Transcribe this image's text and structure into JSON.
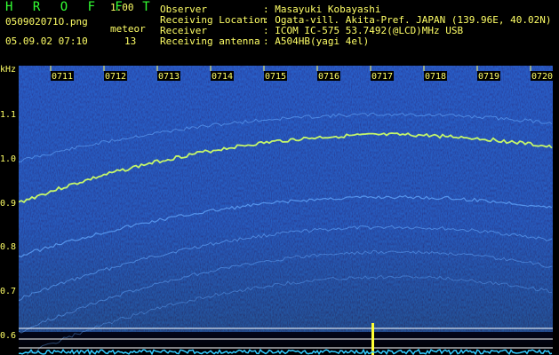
{
  "app": {
    "title": "H R O F F T",
    "version": "1.00"
  },
  "file": {
    "name": "050902071O.png",
    "date_time": "05.09.02 07:10"
  },
  "meteor": {
    "label": "meteor",
    "count": "13"
  },
  "info": {
    "observer_label": "Observer",
    "observer_value": ": Masayuki Kobayashi",
    "location_label": "Receiving Location",
    "location_value": ": Ogata-vill. Akita-Pref. JAPAN (139.96E, 40.02N)",
    "receiver_label": "Receiver",
    "receiver_value": ": ICOM IC-575 53.7492(@LCD)MHz USB",
    "antenna_label": "Receiving antenna",
    "antenna_value": ": A504HB(yagi 4el)"
  },
  "axis": {
    "y_unit": "kHz",
    "y_ticks": [
      "1.1",
      "1.0",
      "0.9",
      "0.8",
      "0.7",
      "0.6"
    ],
    "x_ticks": [
      "0711",
      "0712",
      "0713",
      "0714",
      "0715",
      "0716",
      "0717",
      "0718",
      "0719",
      "0720"
    ]
  },
  "colors": {
    "background": "#000000",
    "spectrogram": "#0a1a6e",
    "text": "#ffff66",
    "title": "#33ff33",
    "trace_bright": "#ccff66",
    "trace_dim": "#66aaff",
    "baseline": "#33ccff"
  }
}
